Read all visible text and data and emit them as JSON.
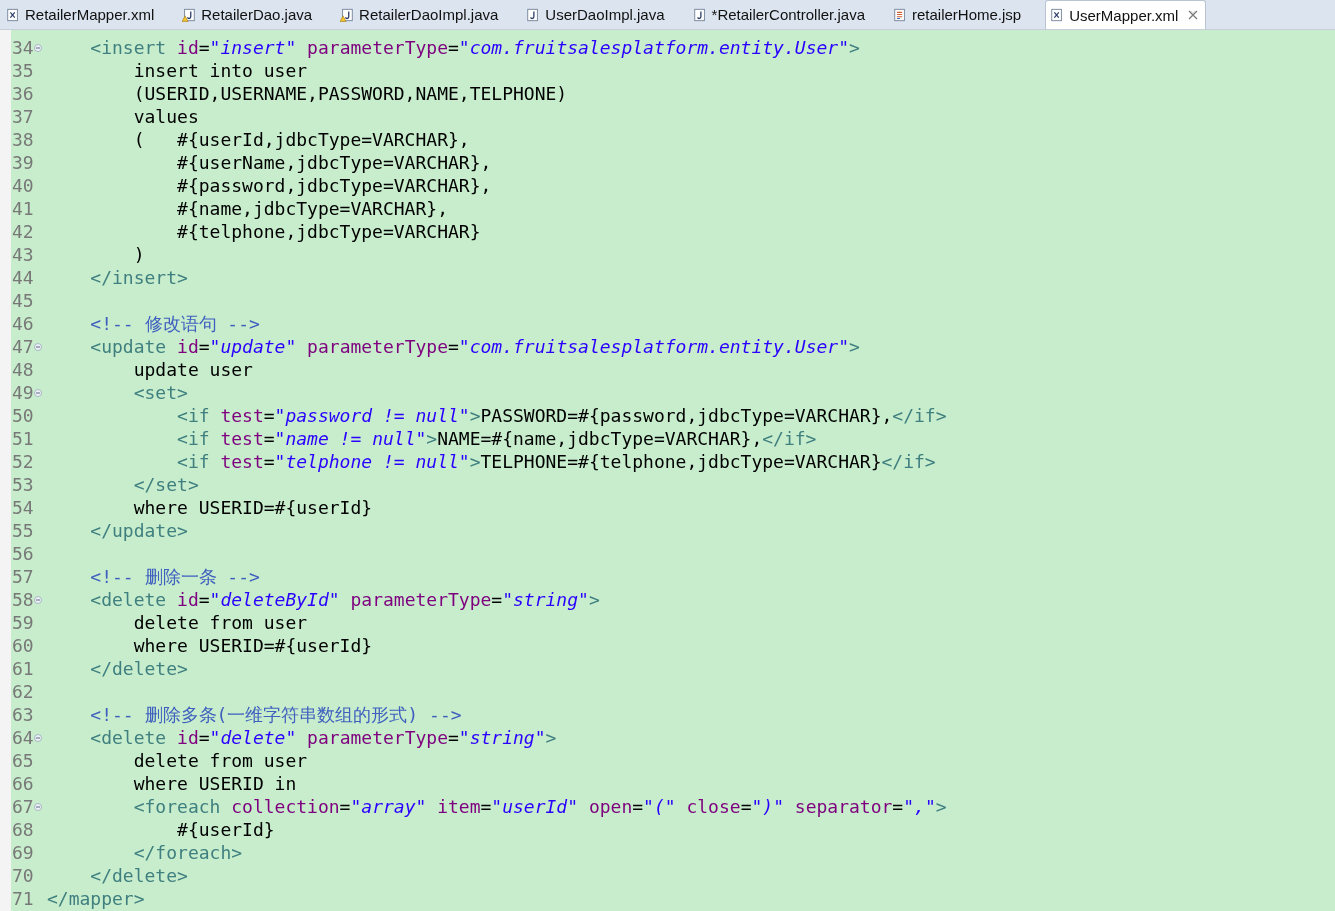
{
  "tabs": [
    {
      "label": "RetailerMapper.xml",
      "kind": "xml",
      "selected": false
    },
    {
      "label": "RetailerDao.java",
      "kind": "warning",
      "selected": false
    },
    {
      "label": "RetailerDaoImpl.java",
      "kind": "warning",
      "selected": false
    },
    {
      "label": "UserDaoImpl.java",
      "kind": "java",
      "selected": false
    },
    {
      "label": "*RetailerController.java",
      "kind": "java",
      "selected": false
    },
    {
      "label": "retailerHome.jsp",
      "kind": "jsp",
      "selected": false
    },
    {
      "label": "UserMapper.xml",
      "kind": "xml",
      "selected": true
    }
  ],
  "lines": [
    {
      "number": "34",
      "foldable": true,
      "tokens": [
        {
          "kind": "tag",
          "text": "    <insert"
        },
        {
          "kind": "attr",
          "text": " id"
        },
        {
          "kind": "text",
          "text": "="
        },
        {
          "kind": "value",
          "text": "\"insert\""
        },
        {
          "kind": "attr",
          "text": " parameterType"
        },
        {
          "kind": "text",
          "text": "="
        },
        {
          "kind": "value",
          "text": "\"com.fruitsalesplatform.entity.User\""
        },
        {
          "kind": "tag",
          "text": ">"
        }
      ]
    },
    {
      "number": "35",
      "foldable": false,
      "tokens": [
        {
          "kind": "text",
          "text": "        insert into user"
        }
      ]
    },
    {
      "number": "36",
      "foldable": false,
      "tokens": [
        {
          "kind": "text",
          "text": "        (USERID,USERNAME,PASSWORD,NAME,TELPHONE)"
        }
      ]
    },
    {
      "number": "37",
      "foldable": false,
      "tokens": [
        {
          "kind": "text",
          "text": "        values"
        }
      ]
    },
    {
      "number": "38",
      "foldable": false,
      "tokens": [
        {
          "kind": "text",
          "text": "        (   #{userId,jdbcType=VARCHAR},"
        }
      ]
    },
    {
      "number": "39",
      "foldable": false,
      "tokens": [
        {
          "kind": "text",
          "text": "            #{userName,jdbcType=VARCHAR},"
        }
      ]
    },
    {
      "number": "40",
      "foldable": false,
      "tokens": [
        {
          "kind": "text",
          "text": "            #{password,jdbcType=VARCHAR},"
        }
      ]
    },
    {
      "number": "41",
      "foldable": false,
      "tokens": [
        {
          "kind": "text",
          "text": "            #{name,jdbcType=VARCHAR},"
        }
      ]
    },
    {
      "number": "42",
      "foldable": false,
      "tokens": [
        {
          "kind": "text",
          "text": "            #{telphone,jdbcType=VARCHAR}"
        }
      ]
    },
    {
      "number": "43",
      "foldable": false,
      "tokens": [
        {
          "kind": "text",
          "text": "        )"
        }
      ]
    },
    {
      "number": "44",
      "foldable": false,
      "tokens": [
        {
          "kind": "tag",
          "text": "    </insert>"
        }
      ]
    },
    {
      "number": "45",
      "foldable": false
    },
    {
      "number": "46",
      "foldable": false,
      "tokens": [
        {
          "kind": "comment",
          "text": "    <!-- 修改语句 -->"
        }
      ]
    },
    {
      "number": "47",
      "foldable": true,
      "tokens": [
        {
          "kind": "tag",
          "text": "    <update"
        },
        {
          "kind": "attr",
          "text": " id"
        },
        {
          "kind": "text",
          "text": "="
        },
        {
          "kind": "value",
          "text": "\"update\""
        },
        {
          "kind": "attr",
          "text": " parameterType"
        },
        {
          "kind": "text",
          "text": "="
        },
        {
          "kind": "value",
          "text": "\"com.fruitsalesplatform.entity.User\""
        },
        {
          "kind": "tag",
          "text": ">"
        }
      ]
    },
    {
      "number": "48",
      "foldable": false,
      "tokens": [
        {
          "kind": "text",
          "text": "        update user"
        }
      ]
    },
    {
      "number": "49",
      "foldable": true,
      "tokens": [
        {
          "kind": "tag",
          "text": "        <set>"
        }
      ]
    },
    {
      "number": "50",
      "foldable": false,
      "tokens": [
        {
          "kind": "tag",
          "text": "            <if"
        },
        {
          "kind": "attr",
          "text": " test"
        },
        {
          "kind": "text",
          "text": "="
        },
        {
          "kind": "value",
          "text": "\"password != null\""
        },
        {
          "kind": "tag",
          "text": ">"
        },
        {
          "kind": "text",
          "text": "PASSWORD=#{password,jdbcType=VARCHAR},"
        },
        {
          "kind": "tag",
          "text": "</if>"
        }
      ]
    },
    {
      "number": "51",
      "foldable": false,
      "tokens": [
        {
          "kind": "tag",
          "text": "            <if"
        },
        {
          "kind": "attr",
          "text": " test"
        },
        {
          "kind": "text",
          "text": "="
        },
        {
          "kind": "value",
          "text": "\"name != null\""
        },
        {
          "kind": "tag",
          "text": ">"
        },
        {
          "kind": "text",
          "text": "NAME=#{name,jdbcType=VARCHAR},"
        },
        {
          "kind": "tag",
          "text": "</if>"
        }
      ]
    },
    {
      "number": "52",
      "foldable": false,
      "tokens": [
        {
          "kind": "tag",
          "text": "            <if"
        },
        {
          "kind": "attr",
          "text": " test"
        },
        {
          "kind": "text",
          "text": "="
        },
        {
          "kind": "value",
          "text": "\"telphone != null\""
        },
        {
          "kind": "tag",
          "text": ">"
        },
        {
          "kind": "text",
          "text": "TELPHONE=#{telphone,jdbcType=VARCHAR}"
        },
        {
          "kind": "tag",
          "text": "</if>"
        }
      ]
    },
    {
      "number": "53",
      "foldable": false,
      "tokens": [
        {
          "kind": "tag",
          "text": "        </set>"
        }
      ]
    },
    {
      "number": "54",
      "foldable": false,
      "tokens": [
        {
          "kind": "text",
          "text": "        where USERID=#{userId}"
        }
      ]
    },
    {
      "number": "55",
      "foldable": false,
      "tokens": [
        {
          "kind": "tag",
          "text": "    </update>"
        }
      ]
    },
    {
      "number": "56",
      "foldable": false
    },
    {
      "number": "57",
      "foldable": false,
      "tokens": [
        {
          "kind": "comment",
          "text": "    <!-- 删除一条 -->"
        }
      ]
    },
    {
      "number": "58",
      "foldable": true,
      "tokens": [
        {
          "kind": "tag",
          "text": "    <delete"
        },
        {
          "kind": "attr",
          "text": " id"
        },
        {
          "kind": "text",
          "text": "="
        },
        {
          "kind": "value",
          "text": "\"deleteById\""
        },
        {
          "kind": "attr",
          "text": " parameterType"
        },
        {
          "kind": "text",
          "text": "="
        },
        {
          "kind": "value",
          "text": "\"string\""
        },
        {
          "kind": "tag",
          "text": ">"
        }
      ]
    },
    {
      "number": "59",
      "foldable": false,
      "tokens": [
        {
          "kind": "text",
          "text": "        delete from user"
        }
      ]
    },
    {
      "number": "60",
      "foldable": false,
      "tokens": [
        {
          "kind": "text",
          "text": "        where USERID=#{userId}"
        }
      ]
    },
    {
      "number": "61",
      "foldable": false,
      "tokens": [
        {
          "kind": "tag",
          "text": "    </delete>"
        }
      ]
    },
    {
      "number": "62",
      "foldable": false
    },
    {
      "number": "63",
      "foldable": false,
      "tokens": [
        {
          "kind": "comment",
          "text": "    <!-- 删除多条(一维字符串数组的形式) -->"
        }
      ]
    },
    {
      "number": "64",
      "foldable": true,
      "tokens": [
        {
          "kind": "tag",
          "text": "    <delete"
        },
        {
          "kind": "attr",
          "text": " id"
        },
        {
          "kind": "text",
          "text": "="
        },
        {
          "kind": "value",
          "text": "\"delete\""
        },
        {
          "kind": "attr",
          "text": " parameterType"
        },
        {
          "kind": "text",
          "text": "="
        },
        {
          "kind": "value",
          "text": "\"string\""
        },
        {
          "kind": "tag",
          "text": ">"
        }
      ]
    },
    {
      "number": "65",
      "foldable": false,
      "tokens": [
        {
          "kind": "text",
          "text": "        delete from user"
        }
      ]
    },
    {
      "number": "66",
      "foldable": false,
      "tokens": [
        {
          "kind": "text",
          "text": "        where USERID in"
        }
      ]
    },
    {
      "number": "67",
      "foldable": true,
      "tokens": [
        {
          "kind": "tag",
          "text": "        <foreach"
        },
        {
          "kind": "attr",
          "text": " collection"
        },
        {
          "kind": "text",
          "text": "="
        },
        {
          "kind": "value",
          "text": "\"array\""
        },
        {
          "kind": "attr",
          "text": " item"
        },
        {
          "kind": "text",
          "text": "="
        },
        {
          "kind": "value",
          "text": "\"userId\""
        },
        {
          "kind": "attr",
          "text": " open"
        },
        {
          "kind": "text",
          "text": "="
        },
        {
          "kind": "value",
          "text": "\"(\""
        },
        {
          "kind": "attr",
          "text": " close"
        },
        {
          "kind": "text",
          "text": "="
        },
        {
          "kind": "value",
          "text": "\")\""
        },
        {
          "kind": "attr",
          "text": " separator"
        },
        {
          "kind": "text",
          "text": "="
        },
        {
          "kind": "value",
          "text": "\",\""
        },
        {
          "kind": "tag",
          "text": ">"
        }
      ]
    },
    {
      "number": "68",
      "foldable": false,
      "tokens": [
        {
          "kind": "text",
          "text": "            #{userId}"
        }
      ]
    },
    {
      "number": "69",
      "foldable": false,
      "tokens": [
        {
          "kind": "tag",
          "text": "        </foreach>"
        }
      ]
    },
    {
      "number": "70",
      "foldable": false,
      "tokens": [
        {
          "kind": "tag",
          "text": "    </delete>"
        }
      ]
    },
    {
      "number": "71",
      "foldable": false,
      "tokens": [
        {
          "kind": "tag",
          "text": "</mapper>"
        }
      ]
    }
  ]
}
